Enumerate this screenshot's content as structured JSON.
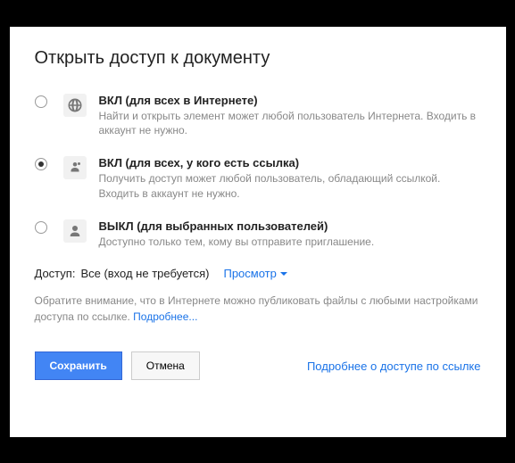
{
  "title": "Открыть доступ к документу",
  "options": [
    {
      "title": "ВКЛ (для всех в Интернете)",
      "desc": "Найти и открыть элемент может любой пользователь Интернета. Входить в аккаунт не нужно.",
      "selected": false,
      "icon": "globe"
    },
    {
      "title": "ВКЛ (для всех, у кого есть ссылка)",
      "desc": "Получить доступ может любой пользователь, обладающий ссылкой. Входить в аккаунт не нужно.",
      "selected": true,
      "icon": "link-person"
    },
    {
      "title": "ВЫКЛ (для выбранных пользователей)",
      "desc": "Доступно только тем, кому вы отправите приглашение.",
      "selected": false,
      "icon": "person"
    }
  ],
  "access": {
    "label": "Доступ:",
    "value": "Все (вход не требуется)",
    "dropdown": "Просмотр"
  },
  "note": {
    "text": "Обратите внимание, что в Интернете можно публиковать файлы с любыми настройками доступа по ссылке. ",
    "link": "Подробнее..."
  },
  "buttons": {
    "save": "Сохранить",
    "cancel": "Отмена"
  },
  "footer_link": "Подробнее о доступе по ссылке"
}
